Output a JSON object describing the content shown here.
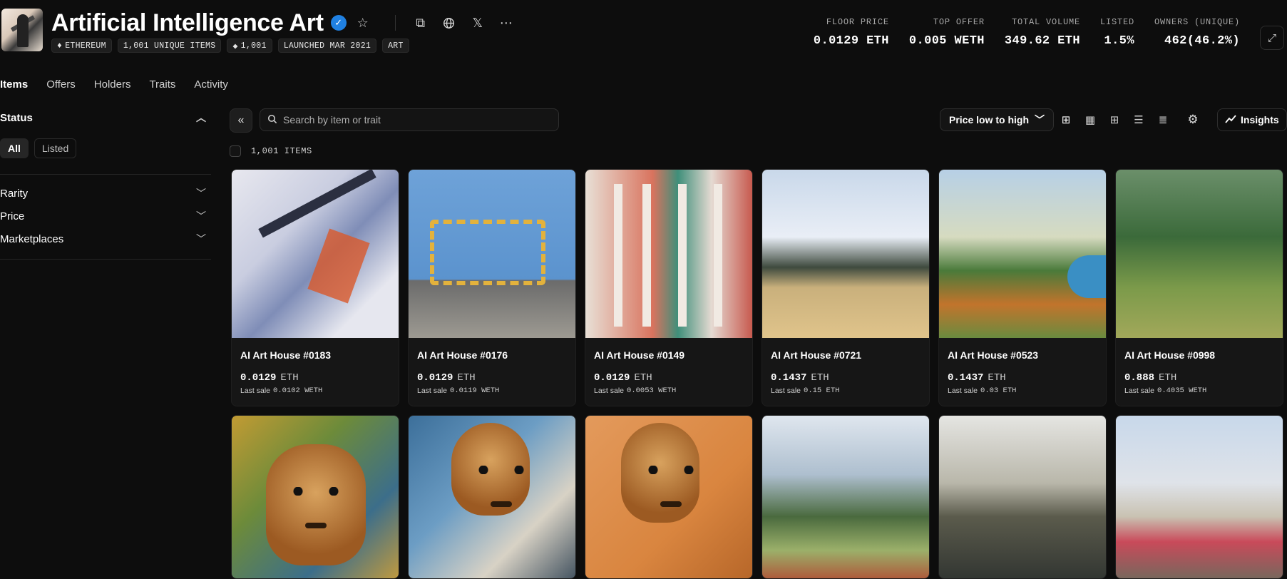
{
  "collection": {
    "title": "Artificial Intelligence Art",
    "badges": [
      "ETHEREUM",
      "1,001 UNIQUE ITEMS",
      "1,001",
      "LAUNCHED MAR 2021",
      "ART"
    ]
  },
  "stats": [
    {
      "label": "FLOOR PRICE",
      "value": "0.0129 ETH"
    },
    {
      "label": "TOP OFFER",
      "value": "0.005 WETH"
    },
    {
      "label": "TOTAL VOLUME",
      "value": "349.62 ETH"
    },
    {
      "label": "LISTED",
      "value": "1.5%"
    },
    {
      "label": "OWNERS (UNIQUE)",
      "value": "462(46.2%)"
    }
  ],
  "tabs": [
    "Items",
    "Offers",
    "Holders",
    "Traits",
    "Activity"
  ],
  "sidebar": {
    "status_label": "Status",
    "status_options": [
      "All",
      "Listed"
    ],
    "filters": [
      "Rarity",
      "Price",
      "Marketplaces"
    ]
  },
  "toolbar": {
    "search_placeholder": "Search by item or trait",
    "sort_label": "Price low to high",
    "insights_label": "Insights",
    "items_count": "1,001 ITEMS"
  },
  "items": [
    {
      "name": "AI Art House #0183",
      "price": "0.0129",
      "unit": "ETH",
      "last_label": "Last sale",
      "last_value": "0.0102 WETH"
    },
    {
      "name": "AI Art House #0176",
      "price": "0.0129",
      "unit": "ETH",
      "last_label": "Last sale",
      "last_value": "0.0119 WETH"
    },
    {
      "name": "AI Art House #0149",
      "price": "0.0129",
      "unit": "ETH",
      "last_label": "Last sale",
      "last_value": "0.0053 WETH"
    },
    {
      "name": "AI Art House #0721",
      "price": "0.1437",
      "unit": "ETH",
      "last_label": "Last sale",
      "last_value": "0.15 ETH"
    },
    {
      "name": "AI Art House #0523",
      "price": "0.1437",
      "unit": "ETH",
      "last_label": "Last sale",
      "last_value": "0.03 ETH"
    },
    {
      "name": "AI Art House #0998",
      "price": "0.888",
      "unit": "ETH",
      "last_label": "Last sale",
      "last_value": "0.4035 WETH"
    }
  ]
}
